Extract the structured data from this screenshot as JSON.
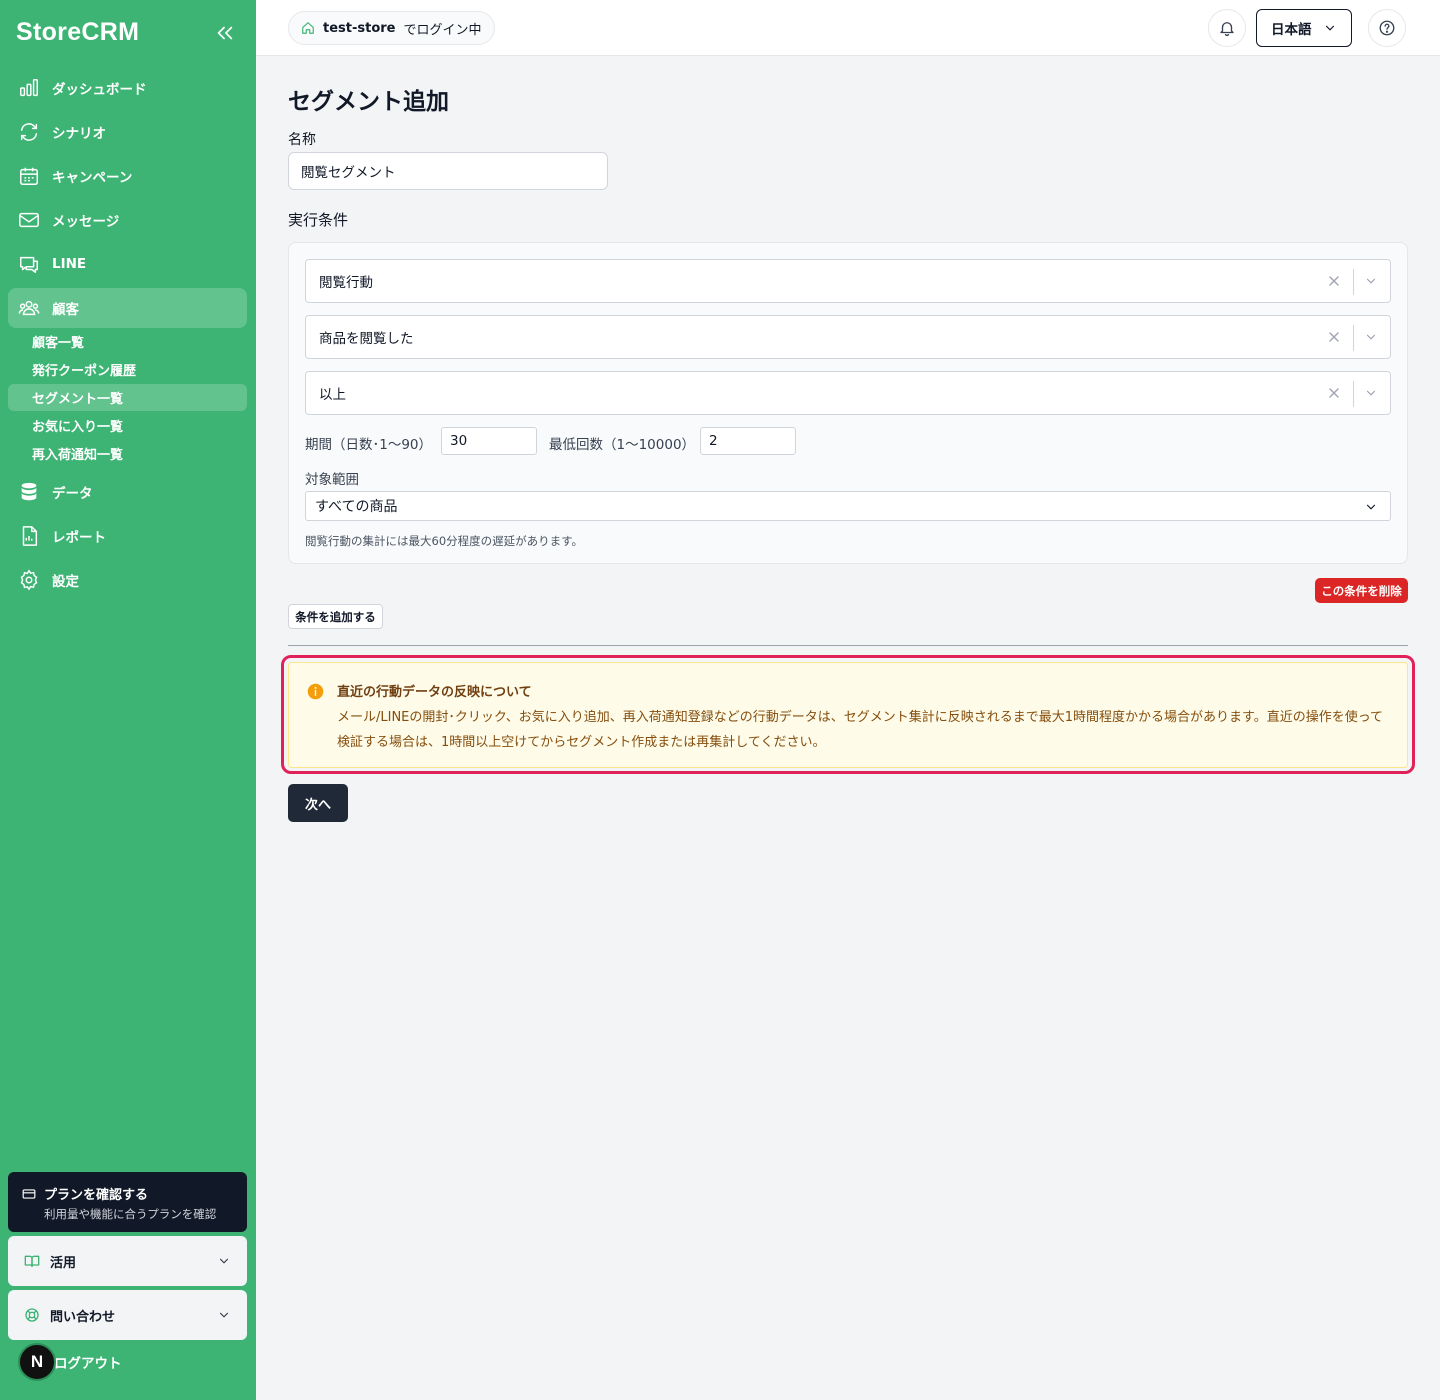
{
  "app": {
    "logo": "StoreCRM"
  },
  "sidebar": {
    "items": [
      {
        "label": "ダッシュボード",
        "icon": "chart-bar-icon"
      },
      {
        "label": "シナリオ",
        "icon": "refresh-icon"
      },
      {
        "label": "キャンペーン",
        "icon": "calendar-icon"
      },
      {
        "label": "メッセージ",
        "icon": "mail-icon"
      },
      {
        "label": "LINE",
        "icon": "chat-icon"
      },
      {
        "label": "顧客",
        "icon": "users-icon"
      },
      {
        "label": "データ",
        "icon": "database-icon"
      },
      {
        "label": "レポート",
        "icon": "report-icon"
      },
      {
        "label": "設定",
        "icon": "gear-icon"
      }
    ],
    "customer_sub": [
      "顧客一覧",
      "発行クーポン履歴",
      "セグメント一覧",
      "お気に入り一覧",
      "再入荷通知一覧"
    ],
    "plan": {
      "title": "プランを確認する",
      "subtitle": "利用量や機能に合うプランを確認"
    },
    "usage": "活用",
    "contact": "問い合わせ",
    "avatar": "N",
    "logout": "ログアウト"
  },
  "header": {
    "store": "test-store",
    "store_suffix": "でログイン中",
    "language": "日本語"
  },
  "page": {
    "title": "セグメント追加",
    "name_label": "名称",
    "name_value": "閲覧セグメント",
    "conditions_label": "実行条件",
    "condition": {
      "type": "閲覧行動",
      "action": "商品を閲覧した",
      "comparison": "以上",
      "period_label": "期間（日数･1〜90）",
      "period_value": "30",
      "min_count_label": "最低回数（1〜10000）",
      "min_count_value": "2",
      "scope_label": "対象範囲",
      "scope_value": "すべての商品",
      "note": "閲覧行動の集計には最大60分程度の遅延があります。"
    },
    "delete_condition": "この条件を削除",
    "add_condition": "条件を追加する",
    "alert": {
      "title": "直近の行動データの反映について",
      "body": "メール/LINEの開封･クリック、お気に入り追加、再入荷通知登録などの行動データは、セグメント集計に反映されるまで最大1時間程度かかる場合があります。直近の操作を使って検証する場合は、1時間以上空けてからセグメント作成または再集計してください。"
    },
    "next": "次へ"
  },
  "colors": {
    "sidebar_bg": "#3db474",
    "danger": "#dc2626",
    "alert_outline": "#e0215a",
    "primary_dark": "#1f2937"
  }
}
